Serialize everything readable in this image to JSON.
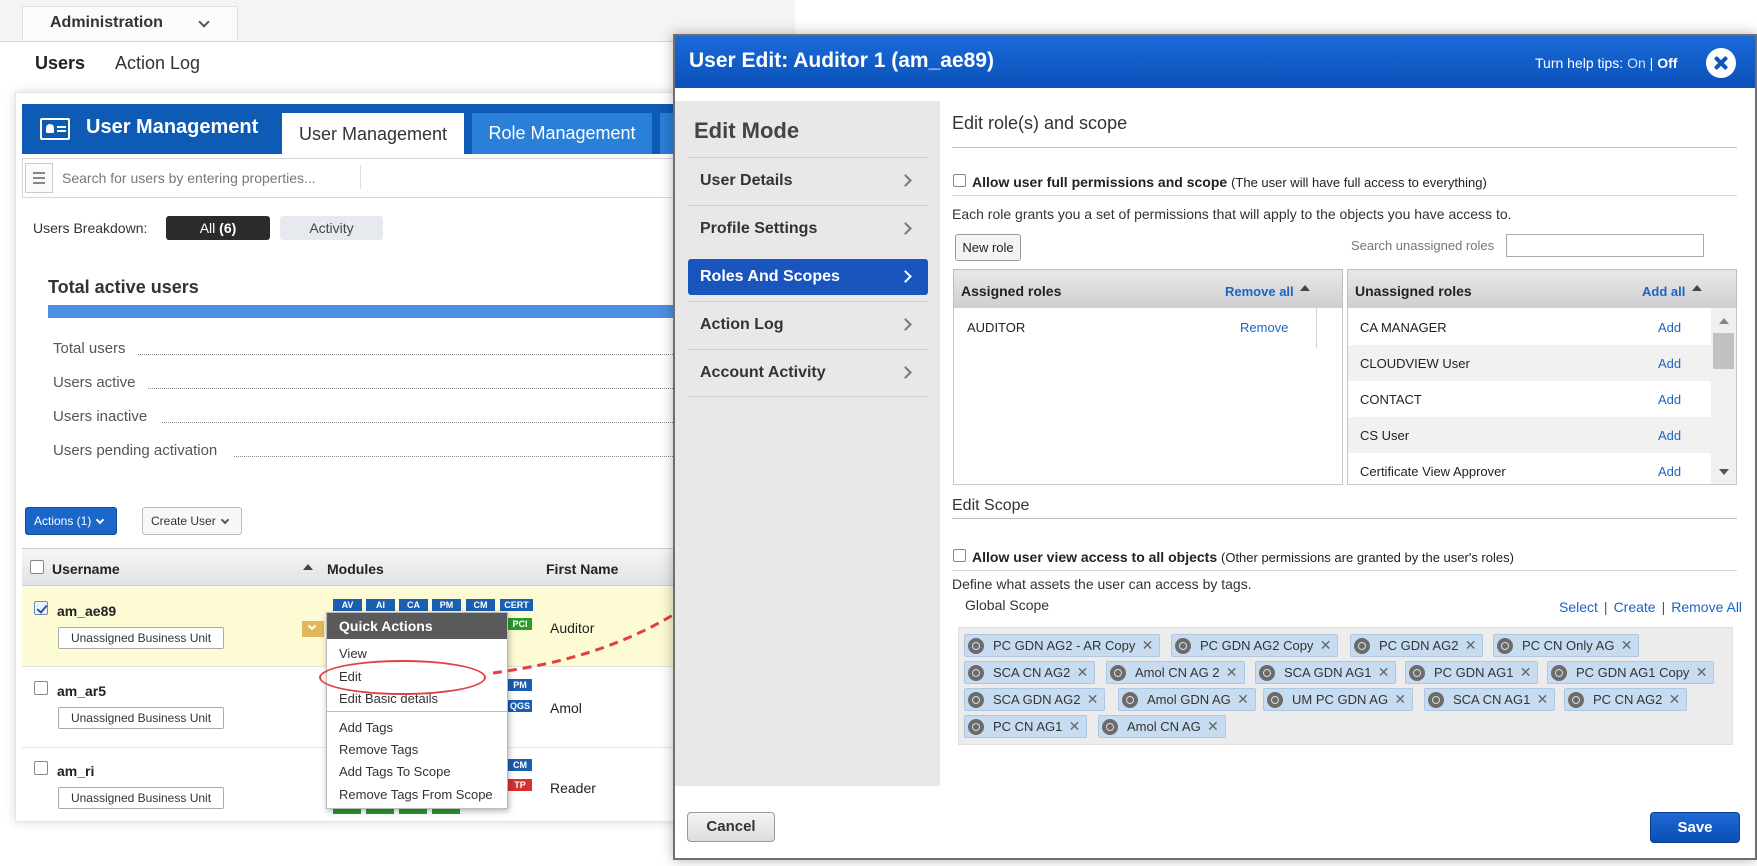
{
  "admin": {
    "title": "Administration"
  },
  "nav": {
    "users": "Users",
    "action_log": "Action Log"
  },
  "user_management": {
    "title": "User Management",
    "tabs": [
      "User Management",
      "Role Management"
    ],
    "search_placeholder": "Search for users by entering properties...",
    "breakdown_label": "Users Breakdown:",
    "breakdown_pills": {
      "all": "All",
      "all_count": "(6)",
      "activity": "Activity"
    },
    "total_active_title": "Total active users",
    "stats": [
      "Total users",
      "Users active",
      "Users inactive",
      "Users pending activation"
    ],
    "actions_btn": "Actions (1)",
    "create_user_btn": "Create User",
    "table_headers": {
      "username": "Username",
      "modules": "Modules",
      "first_name": "First Name"
    },
    "rows": [
      {
        "username": "am_ae89",
        "business_unit": "Unassigned Business Unit",
        "first_name": "Auditor",
        "checked": true
      },
      {
        "username": "am_ar5",
        "business_unit": "Unassigned Business Unit",
        "first_name": "Amol",
        "checked": false
      },
      {
        "username": "am_ri",
        "business_unit": "Unassigned Business Unit",
        "first_name": "Reader",
        "checked": false
      }
    ],
    "module_badges": {
      "row1": [
        "AV",
        "AI",
        "CA",
        "PM",
        "CM",
        "CERT",
        "PCI"
      ],
      "row2": [
        "PM",
        "QGS"
      ],
      "row3": [
        "CM",
        "TP"
      ]
    },
    "quick_actions": {
      "title": "Quick Actions",
      "items": [
        "View",
        "Edit",
        "Edit Basic details",
        "Add Tags",
        "Remove Tags",
        "Add Tags To Scope",
        "Remove Tags From Scope"
      ]
    }
  },
  "modal": {
    "title": "User Edit: Auditor 1 (am_ae89)",
    "help_tips": {
      "label": "Turn help tips:",
      "on": "On",
      "sep": "|",
      "off": "Off"
    },
    "sidebar": {
      "title": "Edit Mode",
      "items": [
        "User Details",
        "Profile Settings",
        "Roles And Scopes",
        "Action Log",
        "Account Activity"
      ],
      "active_index": 2
    },
    "roles": {
      "title": "Edit role(s) and scope",
      "full_perm_bold": "Allow user full permissions and scope",
      "full_perm_note": "(The user will have full access to everything)",
      "info": "Each role grants you a set of permissions that will apply to the objects you have access to.",
      "new_role_btn": "New role",
      "search_unassigned_label": "Search unassigned roles",
      "assigned_header": "Assigned roles",
      "remove_all": "Remove all",
      "assigned": [
        {
          "name": "AUDITOR",
          "action": "Remove"
        }
      ],
      "unassigned_header": "Unassigned roles",
      "add_all": "Add all",
      "unassigned": [
        {
          "name": "CA MANAGER",
          "action": "Add"
        },
        {
          "name": "CLOUDVIEW User",
          "action": "Add"
        },
        {
          "name": "CONTACT",
          "action": "Add"
        },
        {
          "name": "CS User",
          "action": "Add"
        },
        {
          "name": "Certificate View Approver",
          "action": "Add"
        }
      ]
    },
    "scope": {
      "title": "Edit Scope",
      "view_all_bold": "Allow user view access to all objects",
      "view_all_note": "(Other permissions are granted by the user's roles)",
      "info": "Define what assets the user can access by tags.",
      "global_scope": "Global Scope",
      "links": {
        "select": "Select",
        "create": "Create",
        "remove_all": "Remove All"
      },
      "tags": [
        "PC GDN AG2 - AR Copy",
        "PC GDN AG2 Copy",
        "PC GDN AG2",
        "PC CN Only AG",
        "SCA CN AG2",
        "Amol CN AG 2",
        "SCA GDN AG1",
        "PC GDN AG1",
        "PC GDN AG1 Copy",
        "SCA GDN AG2",
        "Amol GDN AG",
        "UM PC GDN AG",
        "SCA CN AG1",
        "PC CN AG2",
        "PC CN AG1",
        "Amol CN AG"
      ]
    },
    "cancel_btn": "Cancel",
    "save_btn": "Save"
  }
}
